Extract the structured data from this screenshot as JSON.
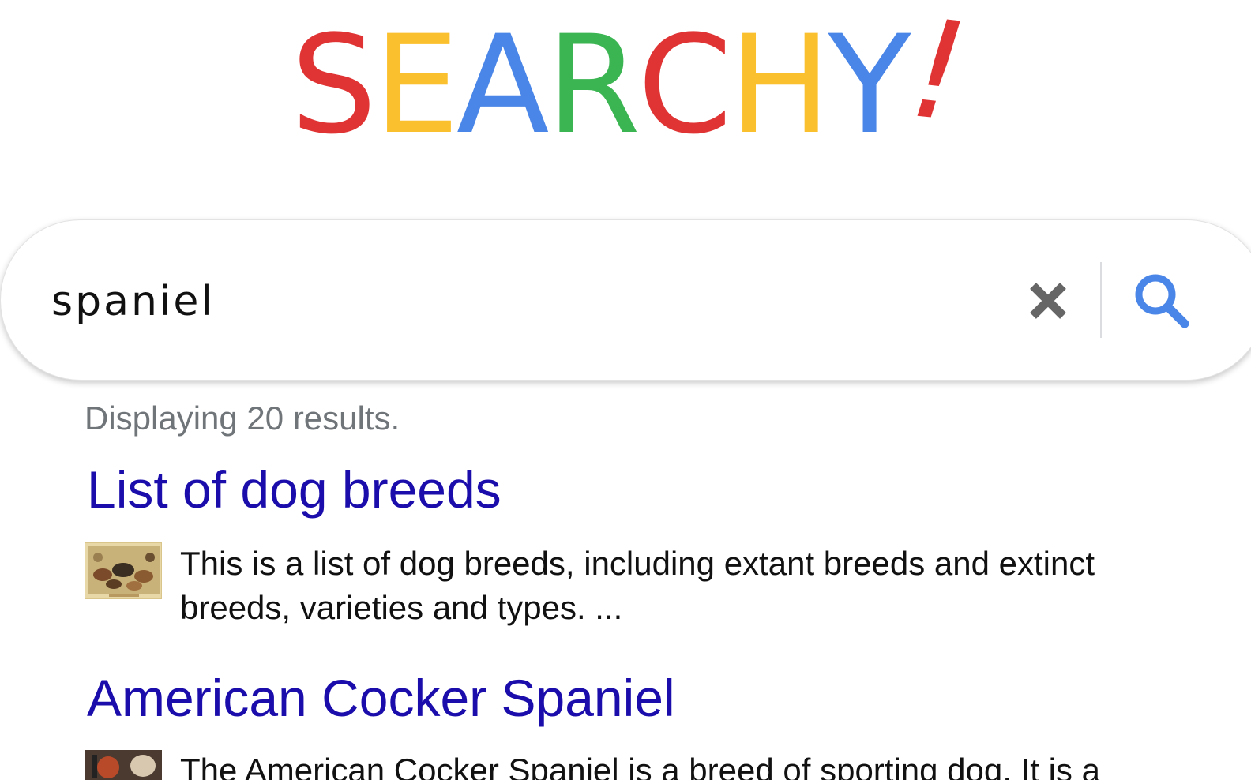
{
  "logo": {
    "letters": [
      {
        "char": "S",
        "color": "#e03434"
      },
      {
        "char": "E",
        "color": "#fbc02d"
      },
      {
        "char": "A",
        "color": "#4a86e8"
      },
      {
        "char": "R",
        "color": "#3bb552"
      },
      {
        "char": "C",
        "color": "#e03434"
      },
      {
        "char": "H",
        "color": "#fbc02d"
      },
      {
        "char": "Y",
        "color": "#4a86e8"
      },
      {
        "char": "!",
        "color": "#e03434"
      }
    ]
  },
  "search": {
    "value": "spaniel",
    "clear_icon": "close-icon",
    "search_icon": "magnifier-icon",
    "search_icon_color": "#4a86e8",
    "clear_icon_color": "#666666"
  },
  "results": {
    "count_text": "Displaying 20 results.",
    "items": [
      {
        "title": "List of dog breeds",
        "snippet": "This is a list of dog breeds, including extant breeds and extinct breeds, varieties and types. ..."
      },
      {
        "title": "American Cocker Spaniel",
        "snippet": "The American Cocker Spaniel is a breed of sporting dog. It is a"
      }
    ]
  },
  "colors": {
    "link": "#1a0dab",
    "muted": "#70757a"
  }
}
